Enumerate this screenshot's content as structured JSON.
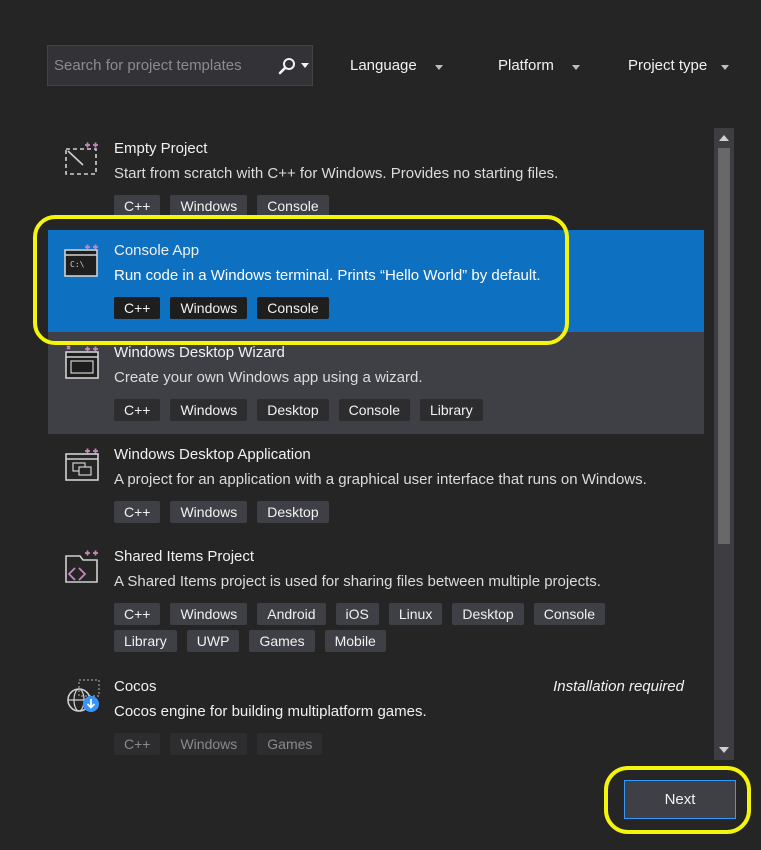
{
  "search": {
    "placeholder": "Search for project templates"
  },
  "filters": [
    {
      "label": "Language"
    },
    {
      "label": "Platform"
    },
    {
      "label": "Project type"
    }
  ],
  "templates": [
    {
      "title": "Empty Project",
      "description": "Start from scratch with C++ for Windows. Provides no starting files.",
      "tags": [
        "C++",
        "Windows",
        "Console"
      ]
    },
    {
      "title": "Console App",
      "description": "Run code in a Windows terminal. Prints “Hello World” by default.",
      "tags": [
        "C++",
        "Windows",
        "Console"
      ],
      "state": "selected"
    },
    {
      "title": "Windows Desktop Wizard",
      "description": "Create your own Windows app using a wizard.",
      "tags": [
        "C++",
        "Windows",
        "Desktop",
        "Console",
        "Library"
      ],
      "state": "hovered"
    },
    {
      "title": "Windows Desktop Application",
      "description": "A project for an application with a graphical user interface that runs on Windows.",
      "tags": [
        "C++",
        "Windows",
        "Desktop"
      ]
    },
    {
      "title": "Shared Items Project",
      "description": "A Shared Items project is used for sharing files between multiple projects.",
      "tags": [
        "C++",
        "Windows",
        "Android",
        "iOS",
        "Linux",
        "Desktop",
        "Console",
        "Library",
        "UWP",
        "Games",
        "Mobile"
      ]
    },
    {
      "title": "Cocos",
      "description": "Cocos engine for building multiplatform games.",
      "tags": [
        "C++",
        "Windows",
        "Games"
      ],
      "note": "Installation required",
      "state": "disabled"
    }
  ],
  "actions": {
    "next_label": "Next"
  },
  "colors": {
    "accent": "#0e70c0",
    "highlight": "#f5f50c",
    "background": "#252526"
  }
}
